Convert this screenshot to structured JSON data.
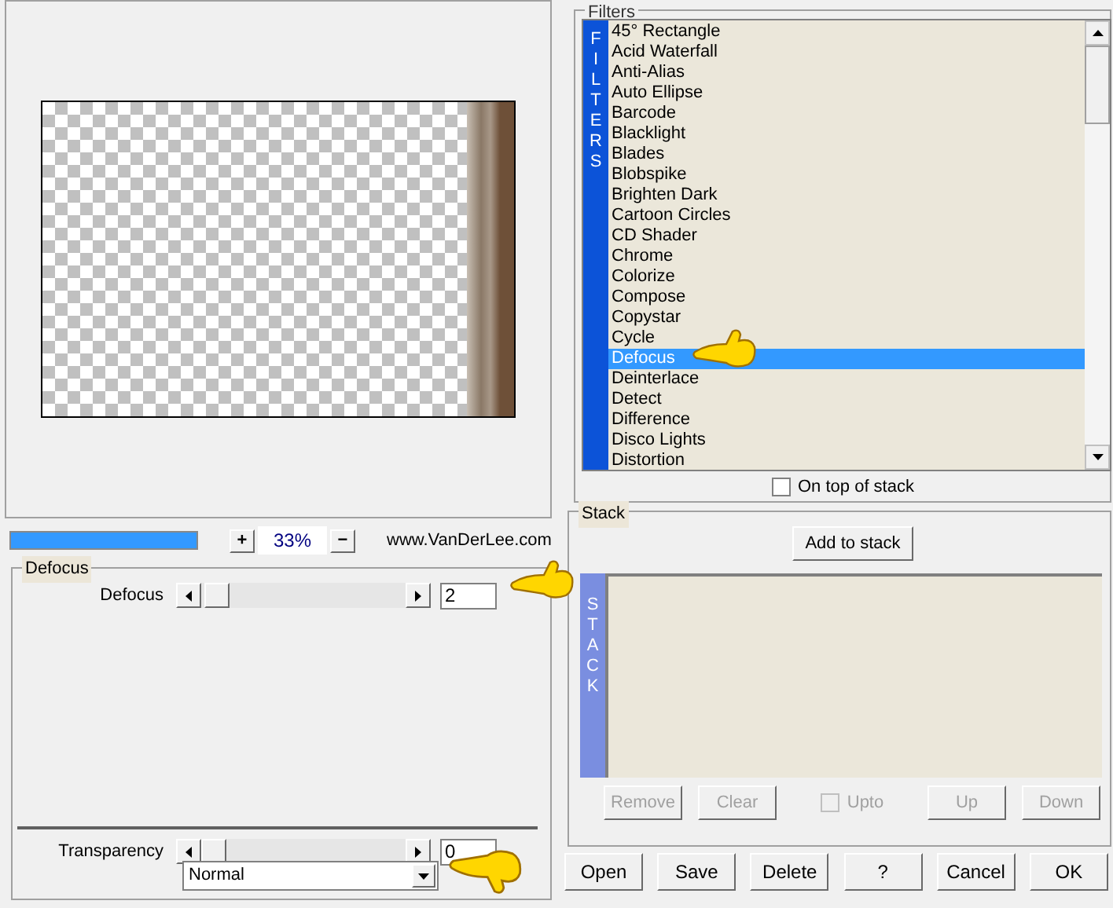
{
  "zoom": {
    "level": 1,
    "plus": "+",
    "value": "33%",
    "minus": "−",
    "website": "www.VanDerLee.com"
  },
  "filter_group": {
    "title": "Defocus",
    "sliders": [
      {
        "label": "Defocus",
        "level": 0.02,
        "value": "2"
      },
      {
        "label": "Transparency",
        "level": 0,
        "value": "0"
      }
    ],
    "blend_mode": "Normal"
  },
  "filters": {
    "title": "Filters",
    "side_label": "FILTERS",
    "items": [
      {
        "label": "45° Rectangle",
        "selected": false
      },
      {
        "label": "Acid Waterfall",
        "selected": false
      },
      {
        "label": "Anti-Alias",
        "selected": false
      },
      {
        "label": "Auto Ellipse",
        "selected": false
      },
      {
        "label": "Barcode",
        "selected": false
      },
      {
        "label": "Blacklight",
        "selected": false
      },
      {
        "label": "Blades",
        "selected": false
      },
      {
        "label": "Blobspike",
        "selected": false
      },
      {
        "label": "Brighten Dark",
        "selected": false
      },
      {
        "label": "Cartoon Circles",
        "selected": false
      },
      {
        "label": "CD Shader",
        "selected": false
      },
      {
        "label": "Chrome",
        "selected": false
      },
      {
        "label": "Colorize",
        "selected": false
      },
      {
        "label": "Compose",
        "selected": false
      },
      {
        "label": "Copystar",
        "selected": false
      },
      {
        "label": "Cycle",
        "selected": false
      },
      {
        "label": "Defocus",
        "selected": true
      },
      {
        "label": "Deinterlace",
        "selected": false
      },
      {
        "label": "Detect",
        "selected": false
      },
      {
        "label": "Difference",
        "selected": false
      },
      {
        "label": "Disco Lights",
        "selected": false
      },
      {
        "label": "Distortion",
        "selected": false
      }
    ],
    "on_top_of_stack": {
      "label": "On top of stack",
      "checked": false
    }
  },
  "stack": {
    "title": "Stack",
    "add_button": "Add to stack",
    "side_label": "STACK",
    "buttons": [
      {
        "label": "Remove",
        "disabled": true
      },
      {
        "label": "Clear",
        "disabled": true
      }
    ],
    "upto": {
      "label": "Upto",
      "checked": false,
      "disabled": true
    },
    "buttons_right": [
      {
        "label": "Up",
        "disabled": true
      },
      {
        "label": "Down",
        "disabled": true
      }
    ]
  },
  "buttons": [
    "Open",
    "Save",
    "Delete",
    "?",
    "Cancel",
    "OK"
  ]
}
